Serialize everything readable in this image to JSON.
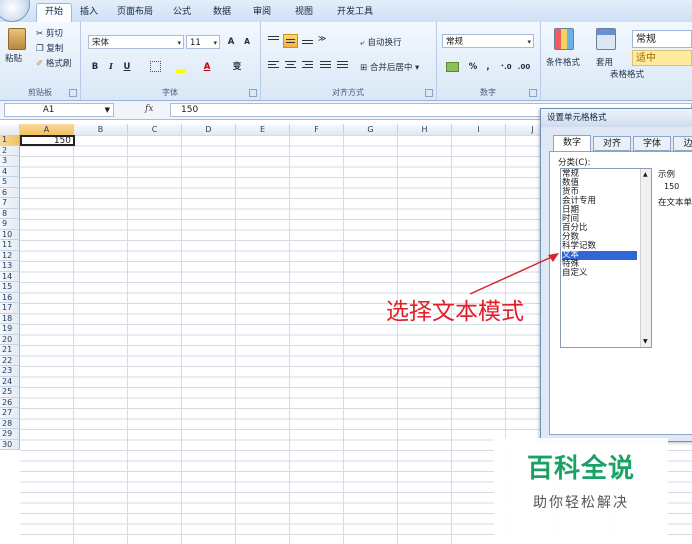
{
  "ribbon": {
    "tabs": [
      "开始",
      "插入",
      "页面布局",
      "公式",
      "数据",
      "审阅",
      "视图",
      "开发工具"
    ],
    "active_tab": "开始",
    "clipboard": {
      "paste": "粘贴",
      "cut": "剪切",
      "copy": "复制",
      "format_painter": "格式刷",
      "label": "剪贴板"
    },
    "font": {
      "name": "宋体",
      "size": "11",
      "bold": "B",
      "italic": "I",
      "underline": "U",
      "grow": "A",
      "shrink": "A",
      "color": "A",
      "phonetic": "变",
      "label": "字体"
    },
    "alignment": {
      "wrap": "自动换行",
      "merge": "合并后居中",
      "label": "对齐方式"
    },
    "number": {
      "format": "常规",
      "percent": "%",
      "comma": ",",
      "label": "数字"
    },
    "styles": {
      "conditional": "条件格式",
      "table": "套用",
      "table2": "表格格式",
      "normal": "常规",
      "neutral": "适中"
    }
  },
  "formula_bar": {
    "name_box": "A1",
    "fx": "fx",
    "value": "150"
  },
  "sheet": {
    "columns": [
      "A",
      "B",
      "C",
      "D",
      "E",
      "F",
      "G",
      "H",
      "I",
      "J"
    ],
    "rows": [
      "1",
      "2",
      "3",
      "4",
      "5",
      "6",
      "7",
      "8",
      "9",
      "10",
      "11",
      "12",
      "13",
      "14",
      "15",
      "16",
      "17",
      "18",
      "19",
      "20",
      "21",
      "22",
      "23",
      "24",
      "25",
      "26",
      "27",
      "28",
      "29",
      "30"
    ],
    "a1_value": "150"
  },
  "dialog": {
    "title": "设置单元格格式",
    "tabs": [
      "数字",
      "对齐",
      "字体",
      "边"
    ],
    "category_label": "分类(C):",
    "categories": [
      "常规",
      "数值",
      "货币",
      "会计专用",
      "日期",
      "时间",
      "百分比",
      "分数",
      "科学记数",
      "文本",
      "特殊",
      "自定义"
    ],
    "selected_category": "文本",
    "sample_label": "示例",
    "sample_value": "150",
    "hint": "在文本单"
  },
  "annotation": "选择文本模式",
  "watermark": {
    "title": "百科全说",
    "subtitle": "助你轻松解决"
  },
  "colors": {
    "accent": "#e0202a",
    "selection": "#3166d6",
    "watermark": "#1aa265"
  }
}
